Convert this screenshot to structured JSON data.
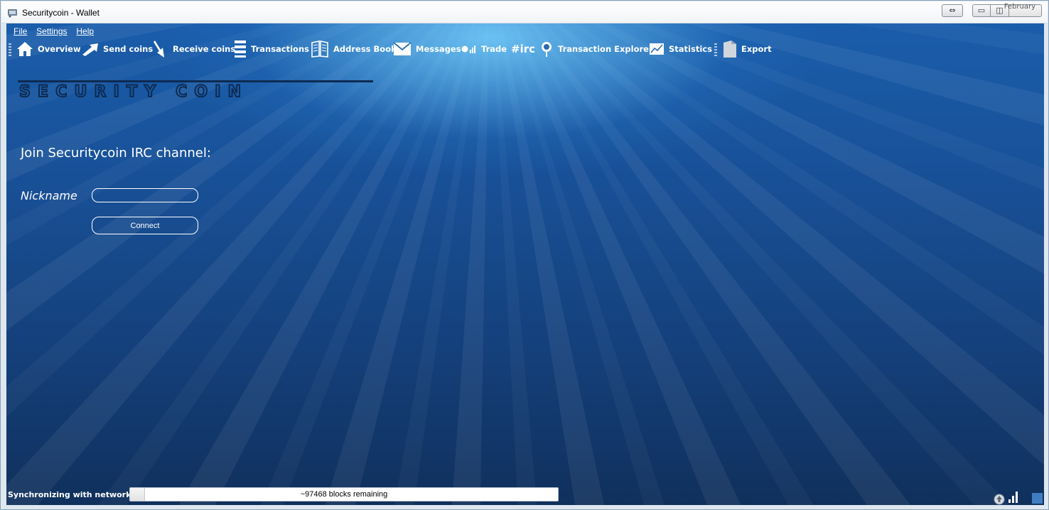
{
  "window": {
    "title": "Securitycoin - Wallet",
    "overflow_text": "February"
  },
  "menu": {
    "items": [
      {
        "label": "File"
      },
      {
        "label": "Settings"
      },
      {
        "label": "Help"
      }
    ]
  },
  "toolbar": {
    "items": [
      {
        "label": "Overview",
        "icon": "home-icon"
      },
      {
        "label": "Send coins",
        "icon": "send-arrow-icon"
      },
      {
        "label": "Receive coins",
        "icon": "receive-arrow-icon"
      },
      {
        "label": "Transactions",
        "icon": "list-icon"
      },
      {
        "label": "Address Book",
        "icon": "book-icon"
      },
      {
        "label": "Messages",
        "icon": "envelope-icon"
      },
      {
        "label": "Trade",
        "icon": "trade-chart-icon"
      },
      {
        "label": "#irc",
        "icon": "irc-icon"
      },
      {
        "label": "Transaction Explorer",
        "icon": "magnifier-icon"
      },
      {
        "label": "Statistics",
        "icon": "statistics-chart-icon"
      },
      {
        "label": "Export",
        "icon": "document-export-icon"
      }
    ]
  },
  "logo": {
    "text": "SECURITY COIN"
  },
  "irc": {
    "heading": "Join Securitycoin IRC channel:",
    "nickname_label": "Nickname",
    "nickname_value": "",
    "connect_label": "Connect"
  },
  "status": {
    "sync_text": "Synchronizing with network...",
    "progress_text": "~97468 blocks remaining",
    "progress_fraction": 0.0
  },
  "colors": {
    "background_top": "#1a5dab",
    "background_bottom": "#10305c",
    "text": "#ffffff"
  }
}
